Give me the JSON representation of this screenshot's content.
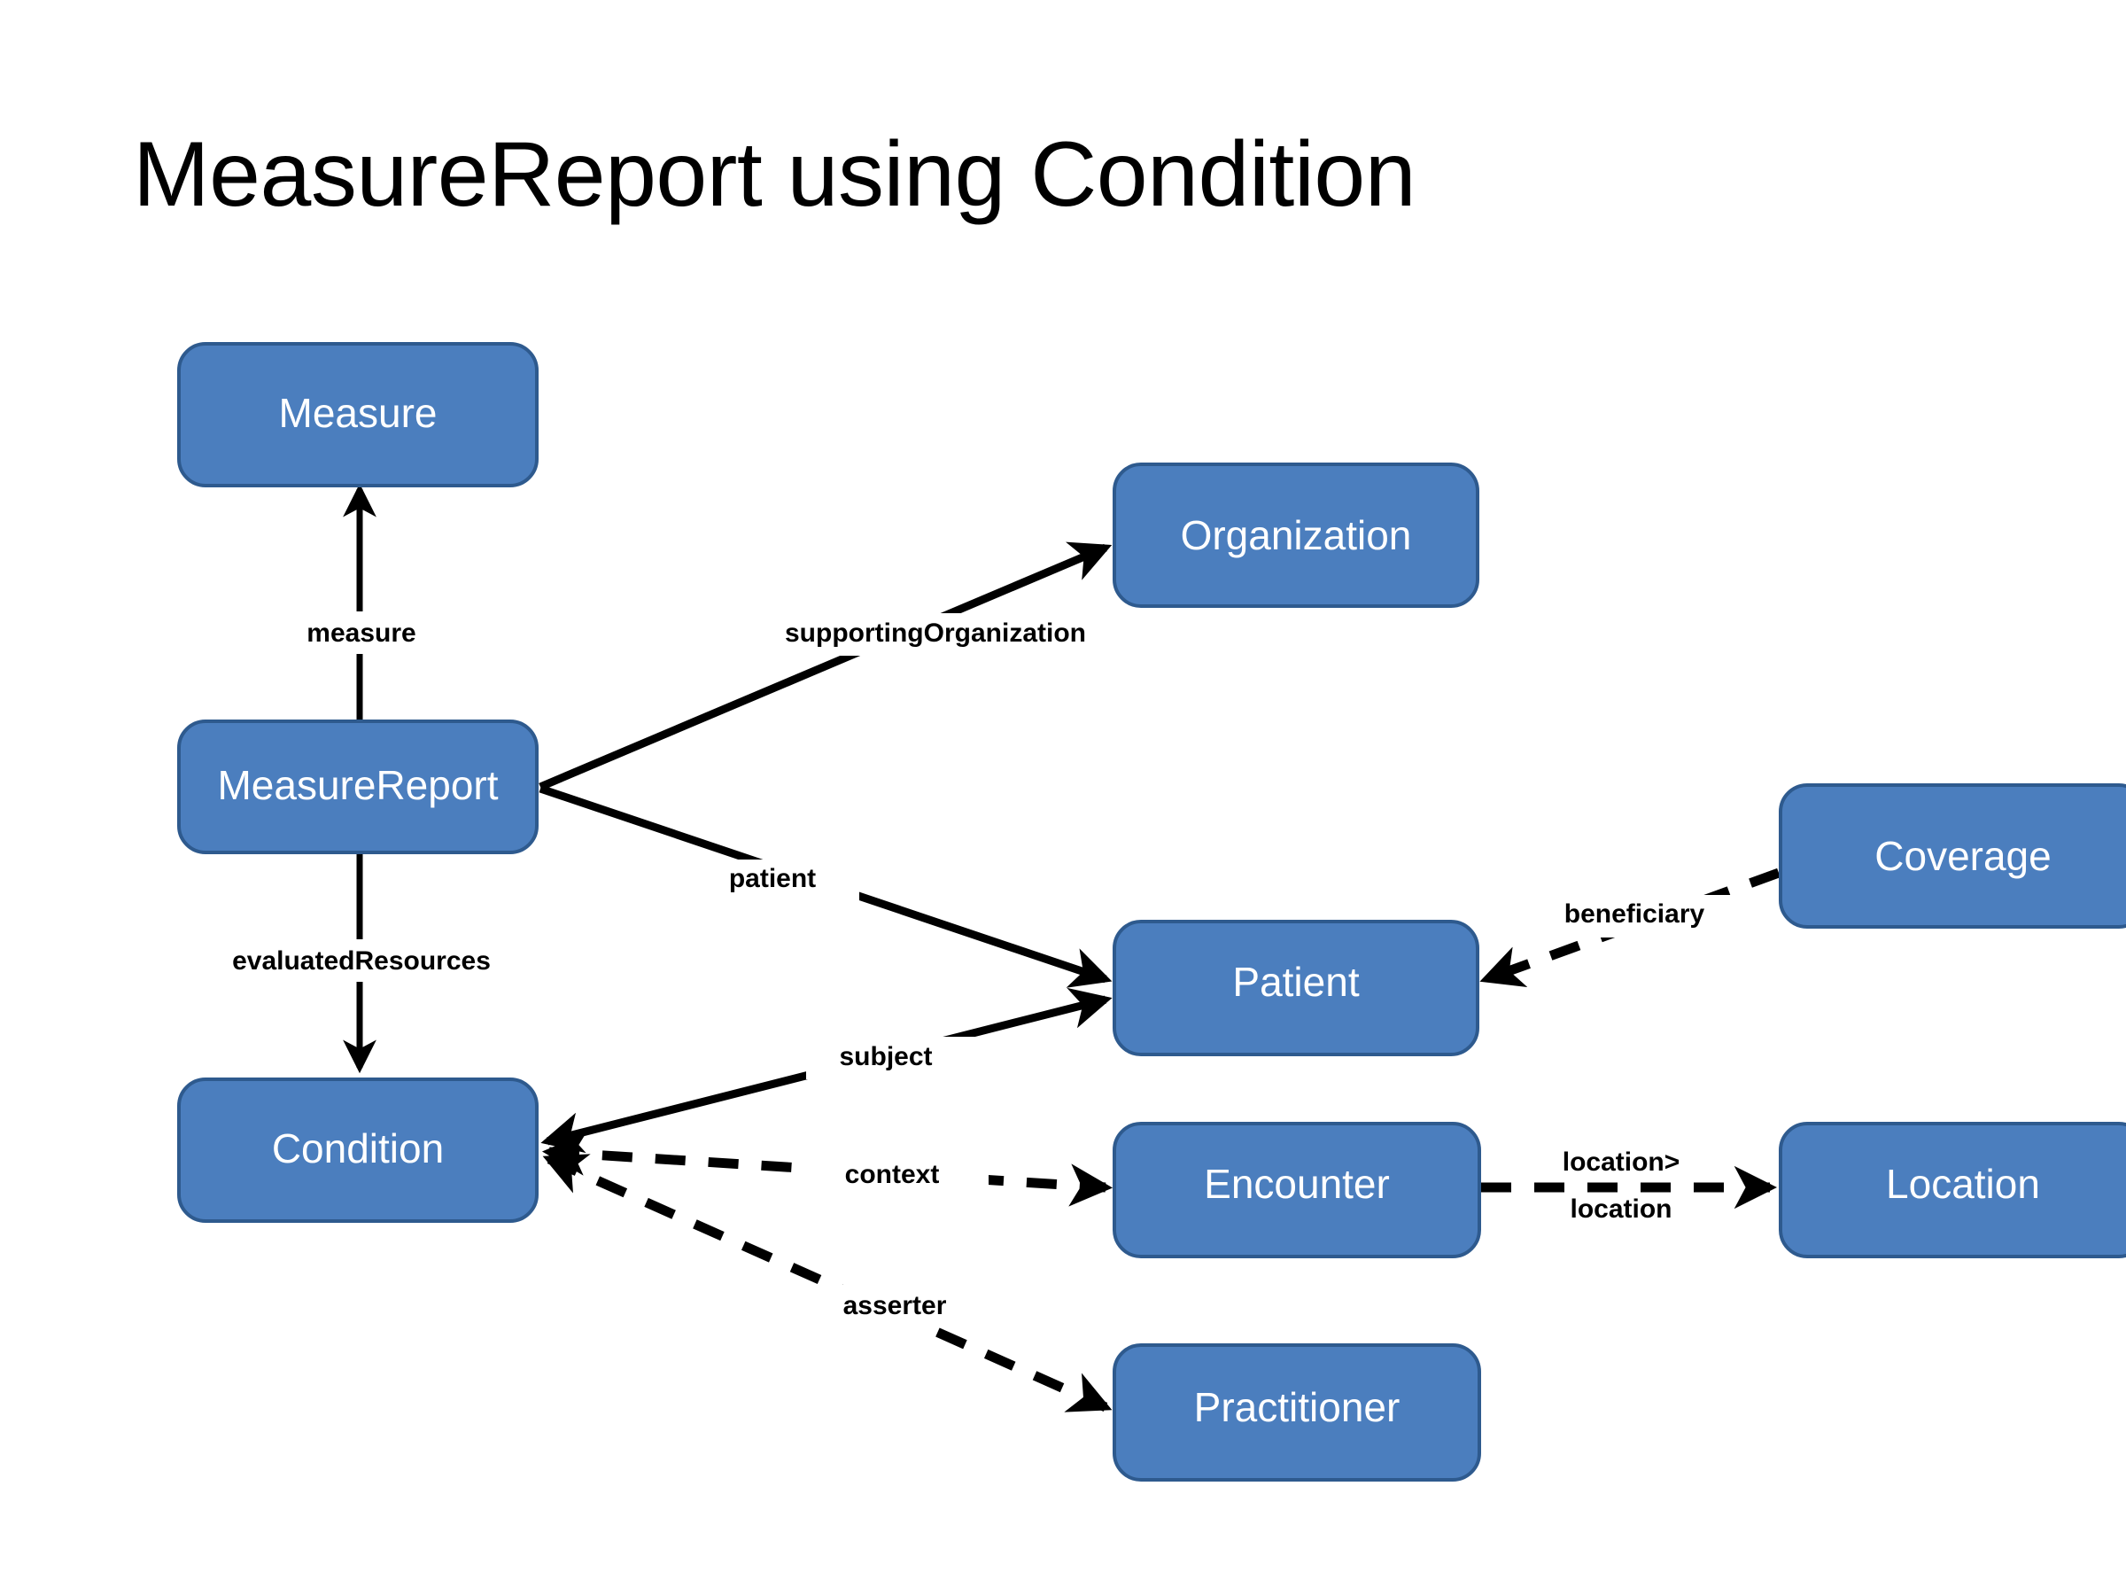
{
  "title": "MeasureReport using Condition",
  "colors": {
    "node_fill": "#4B7EBE",
    "node_stroke": "#2E5A8E",
    "node_text": "#FFFFFF",
    "edge": "#000000",
    "background": "#FFFFFF"
  },
  "nodes": [
    {
      "id": "measure",
      "label": "Measure"
    },
    {
      "id": "measurereport",
      "label": "MeasureReport"
    },
    {
      "id": "condition",
      "label": "Condition"
    },
    {
      "id": "organization",
      "label": "Organization"
    },
    {
      "id": "coverage",
      "label": "Coverage"
    },
    {
      "id": "patient",
      "label": "Patient"
    },
    {
      "id": "encounter",
      "label": "Encounter"
    },
    {
      "id": "location",
      "label": "Location"
    },
    {
      "id": "practitioner",
      "label": "Practitioner"
    }
  ],
  "edges": [
    {
      "id": "measure-edge",
      "label": "measure",
      "from": "measurereport",
      "to": "measure",
      "style": "solid"
    },
    {
      "id": "evaluatedresources-edge",
      "label": "evaluatedResources",
      "from": "measurereport",
      "to": "condition",
      "style": "solid"
    },
    {
      "id": "supportingorganization-edge",
      "label": "supportingOrganization",
      "from": "measurereport",
      "to": "organization",
      "style": "solid"
    },
    {
      "id": "patient-edge",
      "label": "patient",
      "from": "measurereport",
      "to": "patient",
      "style": "solid"
    },
    {
      "id": "subject-edge",
      "label": "subject",
      "from": "condition",
      "to": "patient",
      "style": "solid"
    },
    {
      "id": "context-edge",
      "label": "context",
      "from": "condition",
      "to": "encounter",
      "style": "dashed"
    },
    {
      "id": "asserter-edge",
      "label": "asserter",
      "from": "condition",
      "to": "practitioner",
      "style": "dashed"
    },
    {
      "id": "beneficiary-edge",
      "label": "beneficiary",
      "from": "coverage",
      "to": "patient",
      "style": "dashed"
    },
    {
      "id": "location-edge",
      "label_line1": "location>",
      "label_line2": "location",
      "from": "encounter",
      "to": "location",
      "style": "dashed"
    }
  ]
}
